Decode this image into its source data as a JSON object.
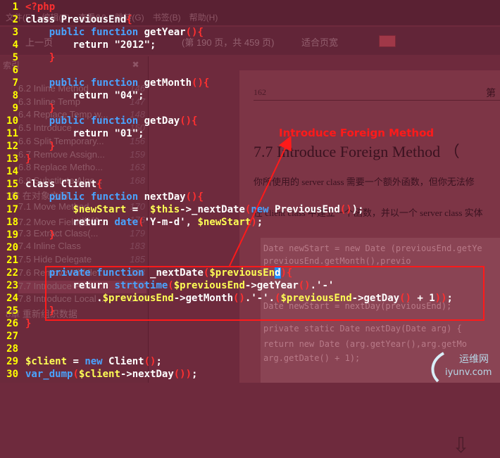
{
  "background_app": {
    "menubar": [
      "文件(F)",
      "编辑(E)",
      "查看(V)",
      "跳转(G)",
      "书签(B)",
      "帮助(H)"
    ],
    "toolbar": {
      "prev_page": "上一页",
      "page_info": "(第 190 页，共 459 页)",
      "fit_width": "适合页宽"
    },
    "sidebar": {
      "header": "索引",
      "close": "✖",
      "items": [
        {
          "label": "6.2 Inline Method",
          "page": "146"
        },
        {
          "label": "6.3 Inline Temp",
          "page": "147"
        },
        {
          "label": "6.4 Replace Temp w...",
          "page": "148"
        },
        {
          "label": "6.5 Introduce ...",
          "page": "150"
        },
        {
          "label": "6.6 Split Temporary...",
          "page": "156"
        },
        {
          "label": "6.7 Remove Assign...",
          "page": "159"
        },
        {
          "label": "6.8 Replace Metho...",
          "page": "163"
        },
        {
          "label": "6.9 Substitute Algo...",
          "page": "168"
        },
        {
          "label": "7章 在对象之间...",
          "page": ""
        },
        {
          "label": "7.1 Move Method",
          "page": "170"
        },
        {
          "label": "7.2 Move Field(搬移...",
          "page": "176"
        },
        {
          "label": "7.3 Extract Class(...",
          "page": "179"
        },
        {
          "label": "7.4 Inline Class",
          "page": "183"
        },
        {
          "label": "7.5 Hide Delegate",
          "page": "185"
        },
        {
          "label": "7.6 Remove Middle ...",
          "page": "188"
        },
        {
          "label": "7.7 Introduce Forei...",
          "page": "190"
        },
        {
          "label": "7.8 Introduce Local ...",
          "page": "192"
        },
        {
          "label": "8章 重新组织数据",
          "page": ""
        }
      ]
    },
    "page": {
      "page_number": "162",
      "page_header_right": "第",
      "section_title": "7.7  Introduce Foreign Method",
      "section_suffix": "（",
      "para1": "你所使用的 server class 需要一个额外函数，但你无法修",
      "para2": "在 client class 中建立一个函数，并以一个 server class 实体",
      "code_lines": [
        "Date newStart = new Date (previousEnd.getYe",
        "        previousEnd.getMonth(),previo",
        "Date newStart = nextDay(previousEnd);",
        "private static Date nextDay(Date arg) {",
        "    return new Date (arg.getYear(),arg.getMo",
        "        arg.getDate() + 1);"
      ],
      "down_arrow_icon": "⇩"
    },
    "watermark": {
      "top": "运维网",
      "bottom": "iyunv.com"
    }
  },
  "editor": {
    "lines": [
      {
        "n": "1",
        "tokens": [
          {
            "t": "tag",
            "v": "<?php"
          }
        ]
      },
      {
        "n": "2",
        "tokens": [
          {
            "t": "plain",
            "v": "class PreviousEnd"
          },
          {
            "t": "br",
            "v": "{"
          }
        ]
      },
      {
        "n": "3",
        "tokens": [
          {
            "t": "plain",
            "v": "    "
          },
          {
            "t": "kw",
            "v": "public"
          },
          {
            "t": "plain",
            "v": " "
          },
          {
            "t": "kw",
            "v": "function"
          },
          {
            "t": "plain",
            "v": " getYear"
          },
          {
            "t": "br",
            "v": "(){"
          }
        ]
      },
      {
        "n": "4",
        "tokens": [
          {
            "t": "plain",
            "v": "        return "
          },
          {
            "t": "str",
            "v": "\"2012\""
          },
          {
            "t": "plain",
            "v": ";"
          }
        ]
      },
      {
        "n": "5",
        "tokens": [
          {
            "t": "plain",
            "v": "    "
          },
          {
            "t": "br",
            "v": "}"
          }
        ]
      },
      {
        "n": "6",
        "tokens": []
      },
      {
        "n": "7",
        "tokens": [
          {
            "t": "plain",
            "v": "    "
          },
          {
            "t": "kw",
            "v": "public"
          },
          {
            "t": "plain",
            "v": " "
          },
          {
            "t": "kw",
            "v": "function"
          },
          {
            "t": "plain",
            "v": " getMonth"
          },
          {
            "t": "br",
            "v": "(){"
          }
        ]
      },
      {
        "n": "8",
        "tokens": [
          {
            "t": "plain",
            "v": "        return "
          },
          {
            "t": "str",
            "v": "\"04\""
          },
          {
            "t": "plain",
            "v": ";"
          }
        ]
      },
      {
        "n": "9",
        "tokens": [
          {
            "t": "plain",
            "v": "    "
          },
          {
            "t": "br",
            "v": "}"
          }
        ]
      },
      {
        "n": "10",
        "tokens": [
          {
            "t": "plain",
            "v": "    "
          },
          {
            "t": "kw",
            "v": "public"
          },
          {
            "t": "plain",
            "v": " "
          },
          {
            "t": "kw",
            "v": "function"
          },
          {
            "t": "plain",
            "v": " getDay"
          },
          {
            "t": "br",
            "v": "(){"
          }
        ]
      },
      {
        "n": "11",
        "tokens": [
          {
            "t": "plain",
            "v": "        return "
          },
          {
            "t": "str",
            "v": "\"01\""
          },
          {
            "t": "plain",
            "v": ";"
          }
        ]
      },
      {
        "n": "12",
        "tokens": [
          {
            "t": "plain",
            "v": "    "
          },
          {
            "t": "br",
            "v": "}"
          }
        ]
      },
      {
        "n": "13",
        "tokens": [
          {
            "t": "br",
            "v": "}"
          }
        ]
      },
      {
        "n": "14",
        "tokens": []
      },
      {
        "n": "15",
        "tokens": [
          {
            "t": "plain",
            "v": "class Client"
          },
          {
            "t": "br",
            "v": "{"
          }
        ]
      },
      {
        "n": "16",
        "tokens": [
          {
            "t": "plain",
            "v": "    "
          },
          {
            "t": "kw",
            "v": "public"
          },
          {
            "t": "plain",
            "v": " "
          },
          {
            "t": "kw",
            "v": "function"
          },
          {
            "t": "plain",
            "v": " nextDay"
          },
          {
            "t": "br",
            "v": "(){"
          }
        ]
      },
      {
        "n": "17",
        "tokens": [
          {
            "t": "plain",
            "v": "        "
          },
          {
            "t": "var",
            "v": "$newStart"
          },
          {
            "t": "plain",
            "v": " =  "
          },
          {
            "t": "var",
            "v": "$this"
          },
          {
            "t": "plain",
            "v": "->_nextDate"
          },
          {
            "t": "br",
            "v": "("
          },
          {
            "t": "kw",
            "v": "new"
          },
          {
            "t": "plain",
            "v": " PreviousEnd"
          },
          {
            "t": "br",
            "v": "()"
          },
          {
            "t": "plain",
            "v": ");"
          }
        ]
      },
      {
        "n": "18",
        "tokens": [
          {
            "t": "plain",
            "v": "        return "
          },
          {
            "t": "kw",
            "v": "date"
          },
          {
            "t": "br",
            "v": "("
          },
          {
            "t": "str",
            "v": "'Y-m-d'"
          },
          {
            "t": "plain",
            "v": ", "
          },
          {
            "t": "var",
            "v": "$newStart"
          },
          {
            "t": "br",
            "v": ")"
          },
          {
            "t": "plain",
            "v": ";"
          }
        ]
      },
      {
        "n": "19",
        "tokens": [
          {
            "t": "plain",
            "v": "    "
          },
          {
            "t": "br",
            "v": "}"
          }
        ]
      },
      {
        "n": "20",
        "tokens": []
      },
      {
        "n": "21",
        "tokens": []
      },
      {
        "n": "22",
        "tokens": [
          {
            "t": "plain",
            "v": "    "
          },
          {
            "t": "kw",
            "v": "private"
          },
          {
            "t": "plain",
            "v": " "
          },
          {
            "t": "kw",
            "v": "function"
          },
          {
            "t": "plain",
            "v": " _nextDate"
          },
          {
            "t": "br",
            "v": "("
          },
          {
            "t": "var",
            "v": "$previousEn"
          },
          {
            "t": "cursor",
            "v": "d"
          },
          {
            "t": "br",
            "v": "){"
          }
        ]
      },
      {
        "n": "23",
        "tokens": [
          {
            "t": "plain",
            "v": "        return "
          },
          {
            "t": "kw",
            "v": "strtotime"
          },
          {
            "t": "br",
            "v": "("
          },
          {
            "t": "var",
            "v": "$previousEnd"
          },
          {
            "t": "plain",
            "v": "->getYear"
          },
          {
            "t": "br",
            "v": "()"
          },
          {
            "t": "plain",
            "v": ".'-'"
          }
        ]
      },
      {
        "n": "24",
        "tokens": [
          {
            "t": "plain",
            "v": "            ."
          },
          {
            "t": "var",
            "v": "$previousEnd"
          },
          {
            "t": "plain",
            "v": "->getMonth"
          },
          {
            "t": "br",
            "v": "()"
          },
          {
            "t": "plain",
            "v": ".'-'."
          },
          {
            "t": "br",
            "v": "("
          },
          {
            "t": "var",
            "v": "$previousEnd"
          },
          {
            "t": "plain",
            "v": "->getDay"
          },
          {
            "t": "br",
            "v": "()"
          },
          {
            "t": "plain",
            "v": " + 1"
          },
          {
            "t": "br",
            "v": "))"
          },
          {
            "t": "plain",
            "v": ";"
          }
        ]
      },
      {
        "n": "25",
        "tokens": [
          {
            "t": "plain",
            "v": "    "
          },
          {
            "t": "br",
            "v": "}"
          }
        ]
      },
      {
        "n": "26",
        "tokens": [
          {
            "t": "br",
            "v": "}"
          }
        ]
      },
      {
        "n": "27",
        "tokens": []
      },
      {
        "n": "28",
        "tokens": []
      },
      {
        "n": "29",
        "tokens": [
          {
            "t": "var",
            "v": "$client"
          },
          {
            "t": "plain",
            "v": " = "
          },
          {
            "t": "kw",
            "v": "new"
          },
          {
            "t": "plain",
            "v": " Client"
          },
          {
            "t": "br",
            "v": "()"
          },
          {
            "t": "plain",
            "v": ";"
          }
        ]
      },
      {
        "n": "30",
        "tokens": [
          {
            "t": "kw",
            "v": "var_dump"
          },
          {
            "t": "br",
            "v": "("
          },
          {
            "t": "var",
            "v": "$client"
          },
          {
            "t": "plain",
            "v": "->nextDay"
          },
          {
            "t": "br",
            "v": "()"
          },
          {
            "t": "br",
            "v": ")"
          },
          {
            "t": "plain",
            "v": ";"
          }
        ]
      }
    ]
  },
  "annotation": {
    "label": "Introduce Foreign Method",
    "color": "#ff1a1a"
  },
  "colors": {
    "keyword": "#4aa3ff",
    "variable": "#ffff55",
    "bracket": "#ff3030",
    "line_number": "#ffff00",
    "background": "#6e2a3d"
  }
}
